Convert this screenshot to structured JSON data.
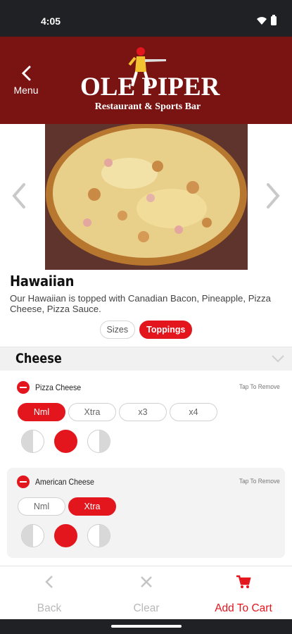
{
  "status_bar": {
    "time": "4:05",
    "wifi_icon": "wifi-icon",
    "battery_icon": "battery-icon"
  },
  "header": {
    "menu_label": "Menu",
    "logo_main": "OLE PIPER",
    "logo_sub": "Restaurant & Sports Bar",
    "background": "#7a1412"
  },
  "gallery": {
    "prev_icon": "chevron-left-icon",
    "next_icon": "chevron-right-icon"
  },
  "product": {
    "name": "Hawaiian",
    "description": "Our Hawaiian is topped with Canadian Bacon, Pineapple, Pizza Cheese, Pizza Sauce."
  },
  "option_tabs": [
    {
      "label": "Sizes",
      "active": false
    },
    {
      "label": "Toppings",
      "active": true
    }
  ],
  "section": {
    "title": "Cheese",
    "chevron_icon": "chevron-down-icon"
  },
  "toppings": [
    {
      "name": "Pizza Cheese",
      "hint": "Tap To Remove",
      "amounts": [
        {
          "label": "Nml",
          "selected": true
        },
        {
          "label": "Xtra",
          "selected": false
        },
        {
          "label": "x3",
          "selected": false
        },
        {
          "label": "x4",
          "selected": false
        }
      ],
      "placement": [
        "left-half",
        "whole",
        "right-half"
      ],
      "selected_placement": "whole"
    },
    {
      "name": "American Cheese",
      "hint": "Tap To Remove",
      "amounts": [
        {
          "label": "Nml",
          "selected": false
        },
        {
          "label": "Xtra",
          "selected": true
        }
      ],
      "placement": [
        "left-half",
        "whole",
        "right-half"
      ],
      "selected_placement": "whole"
    }
  ],
  "bottom_bar": {
    "back_label": "Back",
    "clear_label": "Clear",
    "cart_label": "Add To Cart"
  },
  "colors": {
    "accent": "#e3161e",
    "disabled": "#b9b9b9"
  }
}
